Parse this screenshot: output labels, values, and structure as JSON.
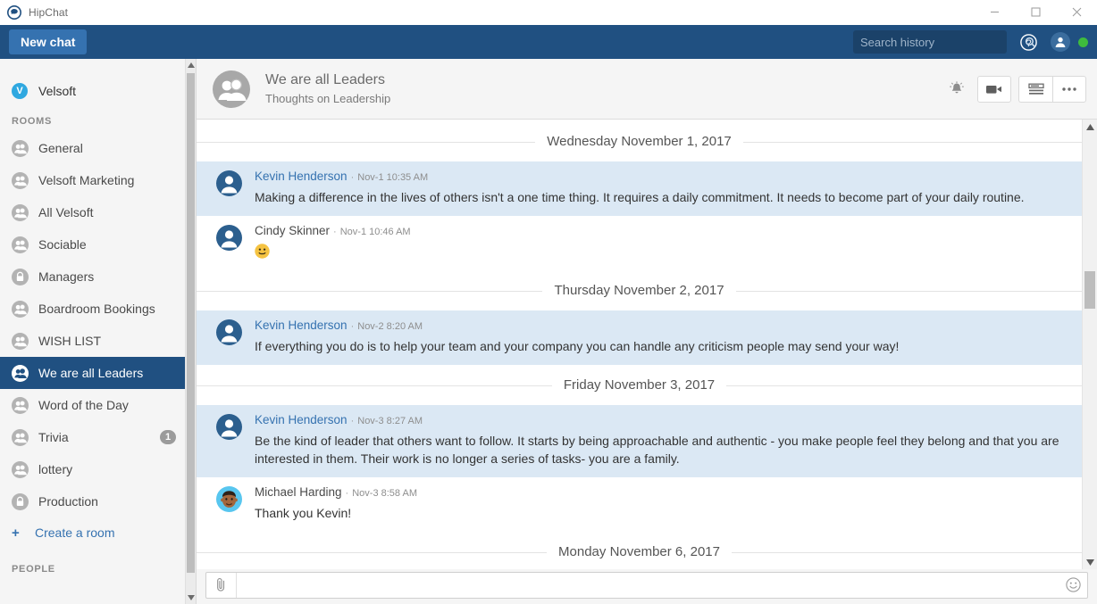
{
  "window": {
    "app_title": "HipChat",
    "logo_icon": "hipchat-logo-icon",
    "minimize_label": "Minimize",
    "maximize_label": "Maximize",
    "close_label": "Close"
  },
  "navbar": {
    "new_chat_label": "New chat",
    "search_placeholder": "Search history",
    "search_value": "",
    "search_icon": "search-icon",
    "help_icon": "help-circle-icon",
    "user_icon": "user-avatar-icon",
    "status_color": "#3ebb3e",
    "accent_color": "#205081",
    "button_color": "#3572b0"
  },
  "sidebar": {
    "team": {
      "name": "Velsoft",
      "initial": "V",
      "color": "#2fa8e0"
    },
    "rooms_header": "ROOMS",
    "people_header": "PEOPLE",
    "create_room_label": "Create a room",
    "rooms": [
      {
        "label": "General",
        "icon": "room-people-icon",
        "private": false,
        "active": false,
        "badge": ""
      },
      {
        "label": "Velsoft Marketing",
        "icon": "room-people-icon",
        "private": false,
        "active": false,
        "badge": ""
      },
      {
        "label": "All Velsoft",
        "icon": "room-people-icon",
        "private": false,
        "active": false,
        "badge": ""
      },
      {
        "label": "Sociable",
        "icon": "room-people-icon",
        "private": false,
        "active": false,
        "badge": ""
      },
      {
        "label": "Managers",
        "icon": "room-lock-icon",
        "private": true,
        "active": false,
        "badge": ""
      },
      {
        "label": "Boardroom Bookings",
        "icon": "room-people-icon",
        "private": false,
        "active": false,
        "badge": ""
      },
      {
        "label": "WISH LIST",
        "icon": "room-people-icon",
        "private": false,
        "active": false,
        "badge": ""
      },
      {
        "label": "We are all Leaders",
        "icon": "room-people-icon",
        "private": false,
        "active": true,
        "badge": ""
      },
      {
        "label": "Word of the Day",
        "icon": "room-people-icon",
        "private": false,
        "active": false,
        "badge": ""
      },
      {
        "label": "Trivia",
        "icon": "room-people-icon",
        "private": false,
        "active": false,
        "badge": "1"
      },
      {
        "label": "lottery",
        "icon": "room-people-icon",
        "private": false,
        "active": false,
        "badge": ""
      },
      {
        "label": "Production",
        "icon": "room-lock-icon",
        "private": true,
        "active": false,
        "badge": ""
      }
    ]
  },
  "chat_header": {
    "room_name": "We are all Leaders",
    "topic": "Thoughts on Leadership",
    "avatar_icon": "room-people-avatar-icon",
    "actions": [
      {
        "name": "notification-bell-icon",
        "label": "Notifications"
      },
      {
        "name": "video-camera-icon",
        "label": "Start video call"
      },
      {
        "name": "summary-panel-icon",
        "label": "Toggle right sidebar"
      },
      {
        "name": "more-options-icon",
        "label": "More options"
      }
    ]
  },
  "messages": [
    {
      "kind": "divider",
      "text": "Wednesday November 1, 2017"
    },
    {
      "kind": "message",
      "author": "Kevin Henderson",
      "separator": "·",
      "time": "Nov-1 10:35 AM",
      "text": "Making a difference in the lives of others isn't a one time thing. It requires a daily commitment. It needs to become part of your daily routine.",
      "mention": true,
      "avatar": "user-blue-avatar",
      "author_link": true,
      "emoji": ""
    },
    {
      "kind": "message",
      "author": "Cindy Skinner",
      "separator": "·",
      "time": "Nov-1 10:46 AM",
      "text": "",
      "mention": false,
      "avatar": "user-blue-avatar",
      "author_link": false,
      "emoji": "slight-smile-emoji"
    },
    {
      "kind": "divider",
      "text": "Thursday November 2, 2017"
    },
    {
      "kind": "message",
      "author": "Kevin Henderson",
      "separator": "·",
      "time": "Nov-2 8:20 AM",
      "text": "If everything you do is to help your team and your company you can handle any criticism people may send your way!",
      "mention": true,
      "avatar": "user-blue-avatar",
      "author_link": true,
      "emoji": ""
    },
    {
      "kind": "divider",
      "text": "Friday November 3, 2017"
    },
    {
      "kind": "message",
      "author": "Kevin Henderson",
      "separator": "·",
      "time": "Nov-3 8:27 AM",
      "text": "Be the kind of leader that others want to follow. It starts by being approachable and authentic - you make people feel they belong and that you are interested in them. Their work is no longer a series of tasks- you are a family.",
      "mention": true,
      "avatar": "user-blue-avatar",
      "author_link": true,
      "emoji": ""
    },
    {
      "kind": "message",
      "author": "Michael Harding",
      "separator": "·",
      "time": "Nov-3 8:58 AM",
      "text": "Thank you Kevin!",
      "mention": false,
      "avatar": "cartoon-face-avatar",
      "author_link": false,
      "emoji": ""
    },
    {
      "kind": "divider",
      "text": "Monday November 6, 2017"
    }
  ],
  "composer": {
    "placeholder": "",
    "value": "",
    "attach_icon": "paperclip-icon",
    "emoji_icon": "smiley-icon"
  }
}
